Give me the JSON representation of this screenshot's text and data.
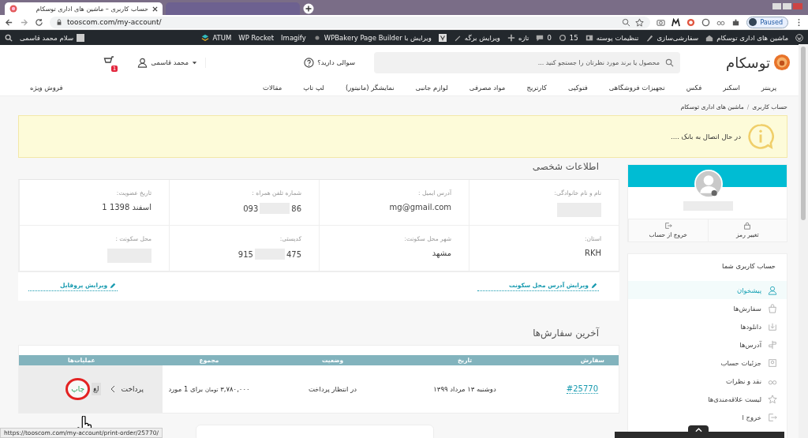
{
  "browser": {
    "tabs": [
      {
        "title": "حساب کاربری – ماشین های اداری توسکام",
        "selected": true
      }
    ],
    "address": "tooscom.com/my-account/",
    "profile_button": "Paused"
  },
  "admin_bar": {
    "items": [
      "ماشین های اداری توسکام",
      "سفارشی‌سازی",
      "تنظیمات پوسته",
      "15",
      "0",
      "تازه",
      "ویرایش برگه",
      "ویرایش با WPBakery Page Builder",
      "Imagify",
      "WP Rocket",
      "ATUM"
    ],
    "greeting": "سلام محمد قاسمی"
  },
  "header": {
    "logo": "توسکام",
    "search": {
      "placeholder": "محصول یا برند مورد نظرتان را جستجو کنید ..."
    },
    "help": "سوالی دارید؟",
    "user": "محمد قاسمی",
    "cart_count": "1"
  },
  "nav": {
    "items": [
      "پرینتر",
      "اسکنر",
      "فکس",
      "تجهیزات فروشگاهی",
      "فتوکپی",
      "کارتریج",
      "مواد مصرفی",
      "لوازم جانبی",
      "نمایشگر (مانیتور)",
      "لپ تاپ",
      "مقالات"
    ],
    "special": "فروش ویژه"
  },
  "breadcrumb": {
    "items": [
      "حساب کاربری",
      "ماشین های اداری توسکام"
    ],
    "separator": "/"
  },
  "notice": "در حال اتصال به بانک ....",
  "personal": {
    "title": "اطلاعات شخصی",
    "fields": [
      {
        "label": "نام و نام خانوادگی:",
        "redacted": true
      },
      {
        "label": "آدرس ایمیل :",
        "value": "mg@gmail.com",
        "redacted": false
      },
      {
        "label": "شماره تلفن همراه :",
        "value": "093",
        "value_end": "86",
        "redacted": true
      },
      {
        "label": "تاریخ عضویت:",
        "value": "1 اسفند 1398",
        "redacted": false
      },
      {
        "label": "استان:",
        "value": "RKH",
        "redacted": false
      },
      {
        "label": "شهر محل سکونت:",
        "value": "مشهد",
        "redacted": false
      },
      {
        "label": "کدپستی:",
        "value": "915",
        "value_end": "475",
        "redacted": true
      },
      {
        "label": "محل سکونت :",
        "redacted": true
      }
    ],
    "links": [
      "ویرایش آدرس محل سکونت",
      "ویرایش پروفایل"
    ]
  },
  "orders": {
    "title": "آخرین سفارش‌ها",
    "columns": [
      "سفارش",
      "تاریخ",
      "وضعیت",
      "مجموع",
      "عملیات‌ها"
    ],
    "rows": [
      {
        "number": "#25770",
        "date": "دوشنبه ۱۳ مرداد ۱۳۹۹",
        "status": "در انتظار پرداخت",
        "amount": "۳,۷۸۰,۰۰۰",
        "currency": "تومان",
        "items": "برای 1 مورد",
        "actions": [
          "پرداخت",
          "لغ",
          "چاپ"
        ]
      }
    ]
  },
  "sidebar": {
    "profile_actions": [
      "تغییر رمز",
      "خروج از حساب"
    ],
    "menu_title": "حساب کاربری شما",
    "items": [
      {
        "label": "پیشخوان",
        "selected": true
      },
      {
        "label": "سفارش‌ها",
        "selected": false
      },
      {
        "label": "دانلودها",
        "selected": false
      },
      {
        "label": "آدرس‌ها",
        "selected": false
      },
      {
        "label": "جزئیات حساب",
        "selected": false
      },
      {
        "label": "نقد و نظرات",
        "selected": false
      },
      {
        "label": "لیست علاقه‌مندی‌ها",
        "selected": false
      },
      {
        "label": "خروج ا",
        "selected": false
      }
    ]
  },
  "status_url": "https://tooscom.com/my-account/print-order/25770/"
}
